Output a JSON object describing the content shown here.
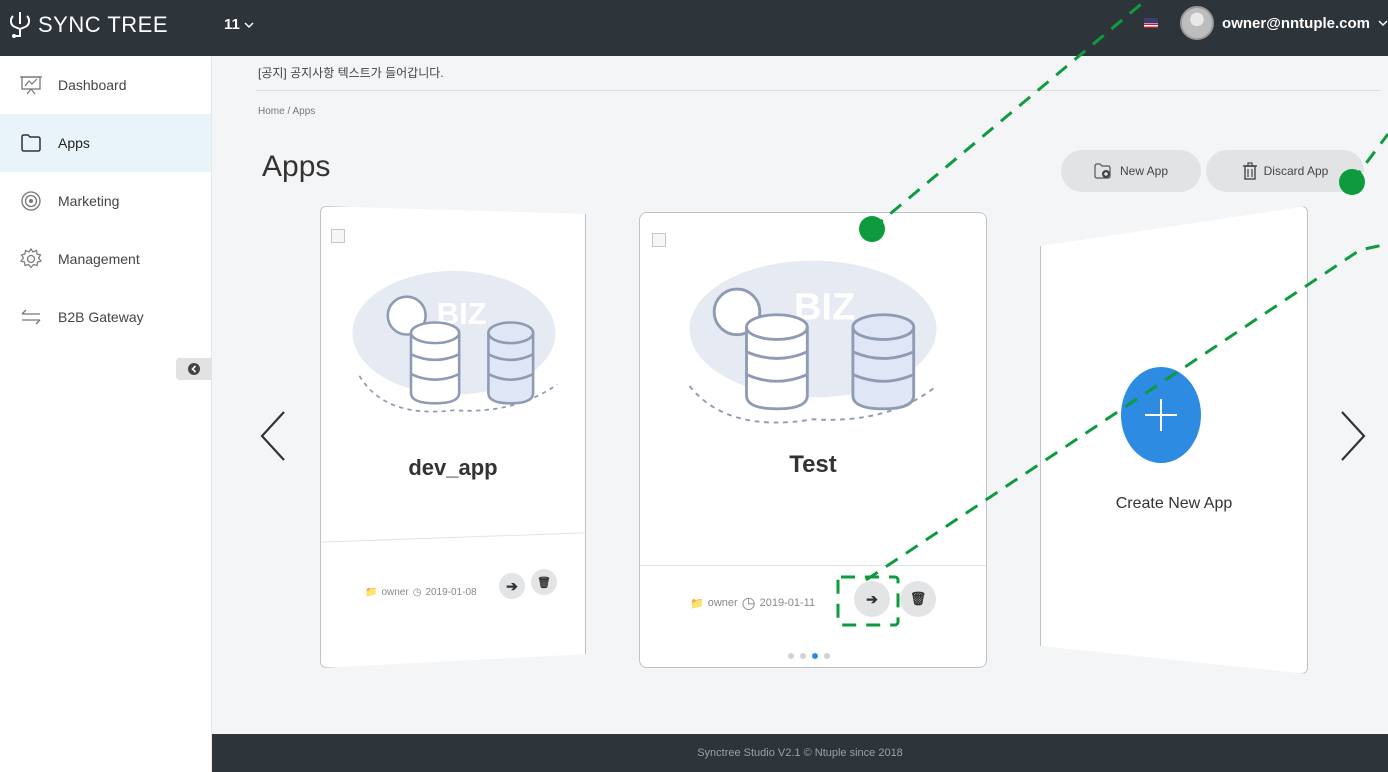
{
  "header": {
    "logo_text": "SYNC TREE",
    "project_selector": "11",
    "user_email": "owner@nntuple.com",
    "flag": "us-flag-icon"
  },
  "sidebar": {
    "items": [
      {
        "label": "Dashboard",
        "icon": "presentation-board-icon"
      },
      {
        "label": "Apps",
        "icon": "folder-icon",
        "active": true
      },
      {
        "label": "Marketing",
        "icon": "target-icon"
      },
      {
        "label": "Management",
        "icon": "gear-icon"
      },
      {
        "label": "B2B Gateway",
        "icon": "exchange-arrows-icon"
      }
    ]
  },
  "main": {
    "notice": "[공지] 공지사항 텍스트가 들어갑니다.",
    "breadcrumb": "Home  /  Apps",
    "title": "Apps",
    "new_app_label": "New App",
    "discard_app_label": "Discard App"
  },
  "cards": [
    {
      "name": "dev_app",
      "owner": "owner",
      "date": "2019-01-08"
    },
    {
      "name": "Test",
      "owner": "owner",
      "date": "2019-01-11"
    }
  ],
  "create_card": {
    "label": "Create New App"
  },
  "carousel": {
    "dots": 4,
    "active_dot": 3
  },
  "footer": {
    "text": "Synctree Studio V2.1 © Ntuple since 2018"
  },
  "colors": {
    "topbar": "#2d343a",
    "accent_blue": "#2d8be2",
    "annotation_green": "#0e9b3e"
  }
}
